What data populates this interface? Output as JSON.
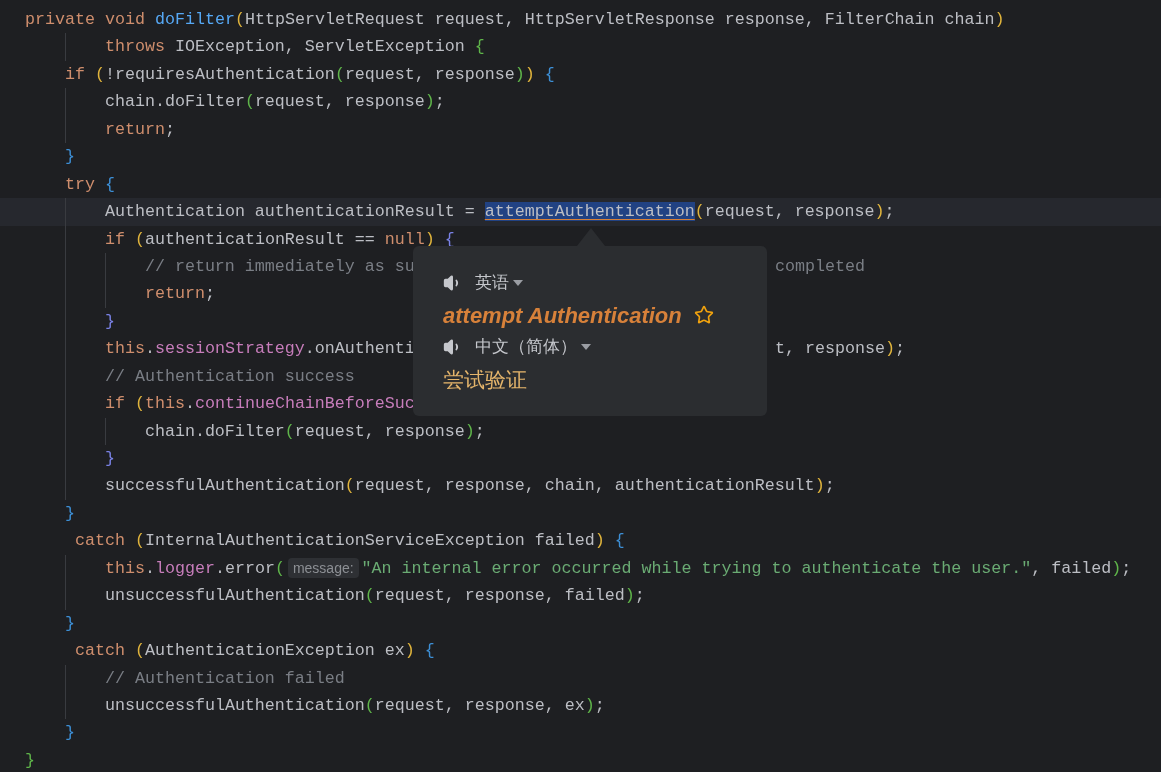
{
  "editor": {
    "lines": [
      {
        "kind": "line",
        "current": false,
        "segments": [
          {
            "kind": "code",
            "tokens": [
              {
                "kind": "kw",
                "text": "private void "
              },
              {
                "kind": "fn",
                "text": "doFilter"
              },
              {
                "kind": "y",
                "text": "("
              },
              {
                "kind": "tx",
                "text": "HttpServletRequest request, HttpServletResponse response, FilterChain chain"
              },
              {
                "kind": "y",
                "text": ")"
              }
            ]
          }
        ],
        "children": [
          {
            "kind": "continuation",
            "current": false,
            "segments": [
              {
                "kind": "code",
                "tokens": [
                  {
                    "kind": "kw",
                    "text": "throws "
                  },
                  {
                    "kind": "tx",
                    "text": "IOException, ServletException "
                  },
                  {
                    "kind": "g",
                    "text": "{"
                  }
                ]
              }
            ]
          },
          {
            "kind": "line",
            "current": false,
            "segments": [
              {
                "kind": "code",
                "tokens": [
                  {
                    "kind": "kw",
                    "text": "if "
                  },
                  {
                    "kind": "y",
                    "text": "("
                  },
                  {
                    "kind": "tx",
                    "text": "!requiresAuthentication"
                  },
                  {
                    "kind": "g",
                    "text": "("
                  },
                  {
                    "kind": "tx",
                    "text": "request, response"
                  },
                  {
                    "kind": "g",
                    "text": ")"
                  },
                  {
                    "kind": "y",
                    "text": ")"
                  },
                  {
                    "kind": "b",
                    "text": " {"
                  }
                ]
              }
            ],
            "children": [
              {
                "kind": "line",
                "current": false,
                "segments": [
                  {
                    "kind": "code",
                    "tokens": [
                      {
                        "kind": "tx",
                        "text": "chain.doFilter"
                      },
                      {
                        "kind": "g",
                        "text": "("
                      },
                      {
                        "kind": "tx",
                        "text": "request, response"
                      },
                      {
                        "kind": "g",
                        "text": ")"
                      },
                      {
                        "kind": "tx",
                        "text": ";"
                      }
                    ]
                  }
                ]
              },
              {
                "kind": "line",
                "current": false,
                "segments": [
                  {
                    "kind": "code",
                    "tokens": [
                      {
                        "kind": "kw",
                        "text": "return"
                      },
                      {
                        "kind": "tx",
                        "text": ";"
                      }
                    ]
                  }
                ]
              }
            ]
          },
          {
            "kind": "line",
            "current": false,
            "segments": [
              {
                "kind": "code",
                "tokens": [
                  {
                    "kind": "b",
                    "text": "}"
                  }
                ]
              }
            ]
          },
          {
            "kind": "line",
            "current": false,
            "segments": [
              {
                "kind": "code",
                "tokens": [
                  {
                    "kind": "kw",
                    "text": "try "
                  },
                  {
                    "kind": "b",
                    "text": "{"
                  }
                ]
              }
            ],
            "children": [
              {
                "kind": "line",
                "current": true,
                "segments": [
                  {
                    "kind": "code",
                    "tokens": [
                      {
                        "kind": "tx",
                        "text": "Authentication authenticationResult = "
                      },
                      {
                        "kind": "sel",
                        "text": "attemptAuthentication"
                      },
                      {
                        "kind": "y",
                        "text": "("
                      },
                      {
                        "kind": "tx",
                        "text": "request, response"
                      },
                      {
                        "kind": "y",
                        "text": ")"
                      },
                      {
                        "kind": "tx",
                        "text": ";"
                      }
                    ]
                  }
                ]
              },
              {
                "kind": "line",
                "current": false,
                "segments": [
                  {
                    "kind": "code",
                    "tokens": [
                      {
                        "kind": "kw",
                        "text": "if "
                      },
                      {
                        "kind": "y",
                        "text": "("
                      },
                      {
                        "kind": "tx",
                        "text": "authenticationResult == "
                      },
                      {
                        "kind": "kw",
                        "text": "null"
                      },
                      {
                        "kind": "y",
                        "text": ")"
                      },
                      {
                        "kind": "v",
                        "text": " {"
                      }
                    ]
                  }
                ],
                "children": [
                  {
                    "kind": "line",
                    "current": false,
                    "segments": [
                      {
                        "kind": "code",
                        "tokens": [
                          {
                            "kind": "cm",
                            "text": "// return immediately as su"
                          }
                        ]
                      },
                      {
                        "kind": "after_popup",
                        "tokens": [
                          {
                            "kind": "cm",
                            "text": "completed"
                          }
                        ]
                      }
                    ]
                  },
                  {
                    "kind": "line",
                    "current": false,
                    "segments": [
                      {
                        "kind": "code",
                        "tokens": [
                          {
                            "kind": "kw",
                            "text": "return"
                          },
                          {
                            "kind": "tx",
                            "text": ";"
                          }
                        ]
                      }
                    ]
                  }
                ]
              },
              {
                "kind": "line",
                "current": false,
                "segments": [
                  {
                    "kind": "code",
                    "tokens": [
                      {
                        "kind": "v",
                        "text": "}"
                      }
                    ]
                  }
                ]
              },
              {
                "kind": "line",
                "current": false,
                "segments": [
                  {
                    "kind": "code",
                    "tokens": [
                      {
                        "kind": "kw",
                        "text": "this"
                      },
                      {
                        "kind": "tx",
                        "text": "."
                      },
                      {
                        "kind": "field",
                        "text": "sessionStrategy"
                      },
                      {
                        "kind": "tx",
                        "text": ".onAuthenti"
                      }
                    ]
                  },
                  {
                    "kind": "after_popup",
                    "tokens": [
                      {
                        "kind": "tx",
                        "text": "t, response"
                      },
                      {
                        "kind": "y",
                        "text": ")"
                      },
                      {
                        "kind": "tx",
                        "text": ";"
                      }
                    ]
                  }
                ]
              },
              {
                "kind": "line",
                "current": false,
                "segments": [
                  {
                    "kind": "code",
                    "tokens": [
                      {
                        "kind": "cm",
                        "text": "// Authentication success"
                      }
                    ]
                  }
                ]
              },
              {
                "kind": "line",
                "current": false,
                "segments": [
                  {
                    "kind": "code",
                    "tokens": [
                      {
                        "kind": "kw",
                        "text": "if "
                      },
                      {
                        "kind": "y",
                        "text": "("
                      },
                      {
                        "kind": "kw",
                        "text": "this"
                      },
                      {
                        "kind": "tx",
                        "text": "."
                      },
                      {
                        "kind": "field",
                        "text": "continueChainBeforeSuc"
                      }
                    ]
                  }
                ],
                "children": [
                  {
                    "kind": "line",
                    "current": false,
                    "segments": [
                      {
                        "kind": "code",
                        "tokens": [
                          {
                            "kind": "tx",
                            "text": "chain.doFilter"
                          },
                          {
                            "kind": "g",
                            "text": "("
                          },
                          {
                            "kind": "tx",
                            "text": "request, response"
                          },
                          {
                            "kind": "g",
                            "text": ")"
                          },
                          {
                            "kind": "tx",
                            "text": ";"
                          }
                        ]
                      }
                    ]
                  }
                ]
              },
              {
                "kind": "line",
                "current": false,
                "segments": [
                  {
                    "kind": "code",
                    "tokens": [
                      {
                        "kind": "v",
                        "text": "}"
                      }
                    ]
                  }
                ]
              },
              {
                "kind": "line",
                "current": false,
                "segments": [
                  {
                    "kind": "code",
                    "tokens": [
                      {
                        "kind": "tx",
                        "text": "successfulAuthentication"
                      },
                      {
                        "kind": "y",
                        "text": "("
                      },
                      {
                        "kind": "tx",
                        "text": "request, response, chain, authenticationResult"
                      },
                      {
                        "kind": "y",
                        "text": ")"
                      },
                      {
                        "kind": "tx",
                        "text": ";"
                      }
                    ]
                  }
                ]
              }
            ]
          },
          {
            "kind": "line",
            "current": false,
            "segments": [
              {
                "kind": "code",
                "tokens": [
                  {
                    "kind": "b",
                    "text": "}"
                  }
                ]
              }
            ]
          },
          {
            "kind": "line",
            "current": false,
            "segments": [
              {
                "kind": "code",
                "tokens": [
                  {
                    "kind": "kw",
                    "text": " catch "
                  },
                  {
                    "kind": "y",
                    "text": "("
                  },
                  {
                    "kind": "tx",
                    "text": "InternalAuthenticationServiceException failed"
                  },
                  {
                    "kind": "y",
                    "text": ")"
                  },
                  {
                    "kind": "b",
                    "text": " {"
                  }
                ]
              }
            ],
            "children": [
              {
                "kind": "line",
                "current": false,
                "segments": [
                  {
                    "kind": "code",
                    "tokens": [
                      {
                        "kind": "kw",
                        "text": "this"
                      },
                      {
                        "kind": "tx",
                        "text": "."
                      },
                      {
                        "kind": "field",
                        "text": "logger"
                      },
                      {
                        "kind": "tx",
                        "text": ".error"
                      },
                      {
                        "kind": "g",
                        "text": "("
                      }
                    ]
                  },
                  {
                    "kind": "hint",
                    "text": "message:"
                  },
                  {
                    "kind": "code",
                    "tokens": [
                      {
                        "kind": "str",
                        "text": "\"An internal error occurred while trying to authenticate the user.\""
                      },
                      {
                        "kind": "tx",
                        "text": ", failed"
                      },
                      {
                        "kind": "g",
                        "text": ")"
                      },
                      {
                        "kind": "tx",
                        "text": ";"
                      }
                    ]
                  }
                ]
              },
              {
                "kind": "line",
                "current": false,
                "segments": [
                  {
                    "kind": "code",
                    "tokens": [
                      {
                        "kind": "tx",
                        "text": "unsuccessfulAuthentication"
                      },
                      {
                        "kind": "g",
                        "text": "("
                      },
                      {
                        "kind": "tx",
                        "text": "request, response, failed"
                      },
                      {
                        "kind": "g",
                        "text": ")"
                      },
                      {
                        "kind": "tx",
                        "text": ";"
                      }
                    ]
                  }
                ]
              }
            ]
          },
          {
            "kind": "line",
            "current": false,
            "segments": [
              {
                "kind": "code",
                "tokens": [
                  {
                    "kind": "b",
                    "text": "}"
                  }
                ]
              }
            ]
          },
          {
            "kind": "line",
            "current": false,
            "segments": [
              {
                "kind": "code",
                "tokens": [
                  {
                    "kind": "kw",
                    "text": " catch "
                  },
                  {
                    "kind": "y",
                    "text": "("
                  },
                  {
                    "kind": "tx",
                    "text": "AuthenticationException ex"
                  },
                  {
                    "kind": "y",
                    "text": ")"
                  },
                  {
                    "kind": "b",
                    "text": " {"
                  }
                ]
              }
            ],
            "children": [
              {
                "kind": "line",
                "current": false,
                "segments": [
                  {
                    "kind": "code",
                    "tokens": [
                      {
                        "kind": "cm",
                        "text": "// Authentication failed"
                      }
                    ]
                  }
                ]
              },
              {
                "kind": "line",
                "current": false,
                "segments": [
                  {
                    "kind": "code",
                    "tokens": [
                      {
                        "kind": "tx",
                        "text": "unsuccessfulAuthentication"
                      },
                      {
                        "kind": "g",
                        "text": "("
                      },
                      {
                        "kind": "tx",
                        "text": "request, response, ex"
                      },
                      {
                        "kind": "g",
                        "text": ")"
                      },
                      {
                        "kind": "tx",
                        "text": ";"
                      }
                    ]
                  }
                ]
              }
            ]
          },
          {
            "kind": "line",
            "current": false,
            "segments": [
              {
                "kind": "code",
                "tokens": [
                  {
                    "kind": "b",
                    "text": "}"
                  }
                ]
              }
            ]
          }
        ]
      },
      {
        "kind": "line",
        "current": false,
        "segments": [
          {
            "kind": "code",
            "tokens": [
              {
                "kind": "g",
                "text": "}"
              }
            ]
          }
        ]
      }
    ]
  },
  "translation_popup": {
    "source_language": "英语",
    "source_text": "attempt Authentication",
    "starred": false,
    "target_language": "中文（简体）",
    "translation": "尝试验证"
  }
}
